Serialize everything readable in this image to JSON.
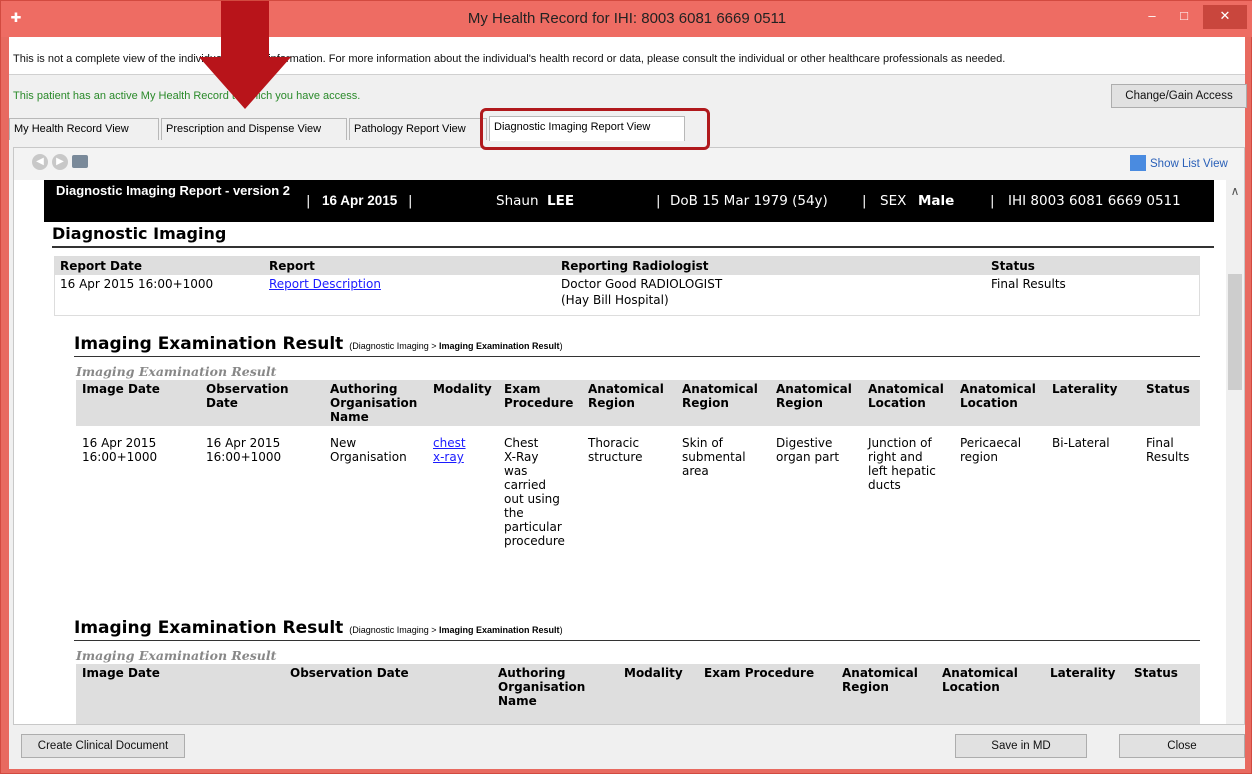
{
  "window": {
    "title": "My Health Record for IHI: 8003 6081 6669 0511",
    "min_label": "–",
    "max_label": "□",
    "close_label": "✕"
  },
  "disclaimer": "This is not a complete view of the individual's health information. For more information about the individual's health record or data, please consult the individual or other healthcare professionals as needed.",
  "access": {
    "status": "This patient has an active My Health Record to which you have access.",
    "button": "Change/Gain Access"
  },
  "tabs": [
    {
      "label": "My Health Record View"
    },
    {
      "label": "Prescription and Dispense View"
    },
    {
      "label": "Pathology Report View"
    },
    {
      "label": "Diagnostic Imaging Report View"
    }
  ],
  "toolbar": {
    "show_list": "Show List View"
  },
  "report_header": {
    "type": "Diagnostic Imaging Report - version 2",
    "date": "16 Apr 2015",
    "sep": "|",
    "patient_first": "Shaun",
    "patient_last": "LEE",
    "dob": "DoB 15 Mar 1979 (54y)",
    "sex_label": "SEX",
    "sex": "Male",
    "ihi": "IHI 8003 6081 6669 0511"
  },
  "section": {
    "title": "Diagnostic Imaging",
    "columns": [
      "Report Date",
      "Report",
      "Reporting Radiologist",
      "Status"
    ],
    "row": {
      "date": "16 Apr 2015 16:00+1000",
      "report": "Report Description",
      "radiologist_1": "Doctor Good RADIOLOGIST",
      "radiologist_2": "(Hay Bill Hospital)",
      "status": "Final Results"
    }
  },
  "result1": {
    "title": "Imaging Examination Result",
    "crumb_prefix": "(Diagnostic Imaging > ",
    "crumb_bold": "Imaging Examination Result",
    "crumb_suffix": ")",
    "caption": "Imaging Examination Result",
    "columns": [
      "Image Date",
      "Observation Date",
      "Authoring Organisation Name",
      "Modality",
      "Exam Procedure",
      "Anatomical Region",
      "Anatomical Region",
      "Anatomical Region",
      "Anatomical Location",
      "Anatomical Location",
      "Laterality",
      "Status"
    ],
    "row": {
      "image_date": "16 Apr 2015\n16:00+1000",
      "obs_date": "16 Apr 2015\n16:00+1000",
      "org": "New\nOrganisation",
      "modality_1": "chest",
      "modality_2": "x-ray",
      "procedure": "Chest\nX-Ray\nwas\ncarried\nout using\nthe\nparticular\nprocedure",
      "region_1": "Thoracic\nstructure",
      "region_2": "Skin of\nsubmental\narea",
      "region_3": "Digestive\norgan part",
      "location_1": "Junction of\nright and\nleft hepatic\nducts",
      "location_2": "Pericaecal\nregion",
      "laterality": "Bi-Lateral",
      "status": "Final\nResults"
    }
  },
  "result2": {
    "title": "Imaging Examination Result",
    "crumb_prefix": "(Diagnostic Imaging > ",
    "crumb_bold": "Imaging Examination Result",
    "crumb_suffix": ")",
    "caption": "Imaging Examination Result",
    "columns": [
      "Image Date",
      "Observation Date",
      "Authoring Organisation Name",
      "Modality",
      "Exam Procedure",
      "Anatomical Region",
      "Anatomical Location",
      "Laterality",
      "Status"
    ]
  },
  "bottom": {
    "create": "Create Clinical Document",
    "save": "Save in MD",
    "close": "Close"
  },
  "colors": {
    "title_bar": "#ee6c63",
    "access_text": "#2a8a2a",
    "highlight": "#b0191c",
    "header_bar": "#000000",
    "link": "#1a1aff"
  }
}
